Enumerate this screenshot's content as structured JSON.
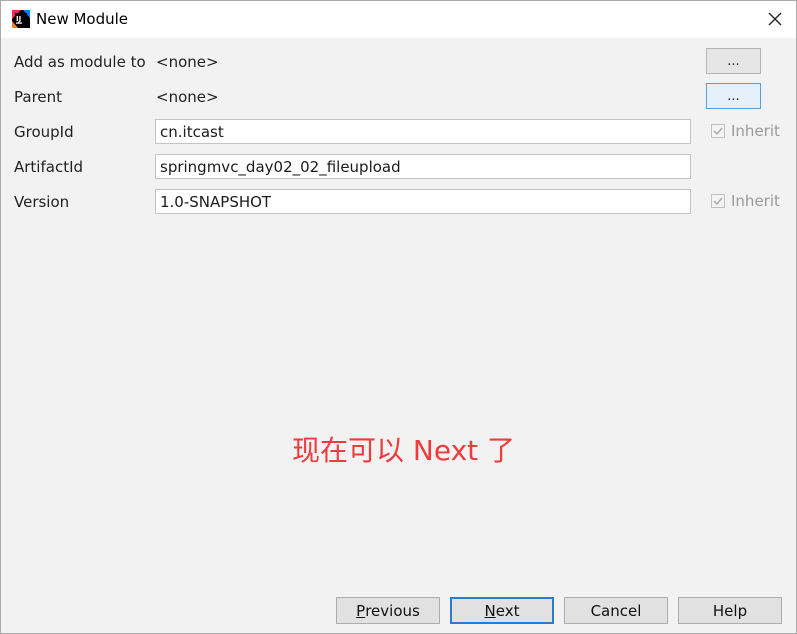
{
  "window": {
    "title": "New Module",
    "app_icon": "intellij-idea-icon",
    "close_icon": "close-icon"
  },
  "form": {
    "add_as_module_to": {
      "label": "Add as module to",
      "value": "<none>",
      "button": "..."
    },
    "parent": {
      "label": "Parent",
      "value": "<none>",
      "button": "..."
    },
    "group_id": {
      "label": "GroupId",
      "value": "cn.itcast",
      "inherit_label": "Inherit",
      "inherit_checked": true
    },
    "artifact_id": {
      "label": "ArtifactId",
      "value": "springmvc_day02_02_fileupload"
    },
    "version": {
      "label": "Version",
      "value": "1.0-SNAPSHOT",
      "inherit_label": "Inherit",
      "inherit_checked": true
    }
  },
  "annotation": "现在可以 Next 了",
  "buttons": {
    "previous": {
      "mnemonic": "P",
      "rest": "revious"
    },
    "next": {
      "mnemonic": "N",
      "rest": "ext"
    },
    "cancel": "Cancel",
    "help": "Help"
  },
  "colors": {
    "annotation": "#ee3b3b",
    "focus_border": "#2a7ad2"
  }
}
